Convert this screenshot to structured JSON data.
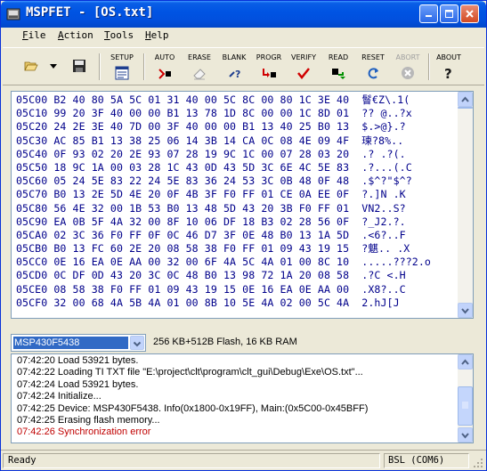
{
  "window": {
    "title": "MSPFET - [OS.txt]"
  },
  "menu": {
    "file": "File",
    "action": "Action",
    "tools": "Tools",
    "help": "Help"
  },
  "toolbar": {
    "setup": "SETUP",
    "auto": "AUTO",
    "erase": "ERASE",
    "blank": "BLANK",
    "program": "PROGR",
    "verify": "VERIFY",
    "read": "READ",
    "reset": "RESET",
    "abort": "ABORT",
    "about": "ABOUT"
  },
  "hex": {
    "rows": [
      "05C00 B2 40 80 5A 5C 01 31 40 00 5C 8C 00 80 1C 3E 40  鬙€Z\\.1(",
      "05C10 99 20 3F 40 00 00 B1 13 78 1D 8C 00 00 1C 8D 01  ?? @..?x",
      "05C20 24 2E 3E 40 7D 00 3F 40 00 00 B1 13 40 25 B0 13  $.>@}.?",
      "05C30 AC 85 B1 13 38 25 06 14 3B 14 CA 0C 08 4E 09 4F  瑓?8%..",
      "05C40 0F 93 02 20 2E 93 07 28 19 9C 1C 00 07 28 03 20  .? .?(.",
      "05C50 18 9C 1A 00 03 28 1C 43 0D 43 5D 3C 6E 4C 5E 83  .?...(.C",
      "05C60 05 24 5E 83 22 24 5E 83 36 24 53 3C 0B 48 0F 48  .$^?\"$^?",
      "05C70 B0 13 2E 5D 4E 20 0F 4B 3F F0 FF 01 CE 0A EE 0F  ?.]N .K",
      "05C80 56 4E 32 00 1B 53 B0 13 48 5D 43 20 3B F0 FF 01  VN2..S?",
      "05C90 EA 0B 5F 4A 32 00 8F 10 06 DF 18 B3 02 28 56 0F  ?_J2.?.",
      "05CA0 02 3C 36 F0 FF 0F 0C 46 D7 3F 0E 48 B0 13 1A 5D  .<6?..F",
      "05CB0 B0 13 FC 60 2E 20 08 58 38 F0 FF 01 09 43 19 15  ?魌.. .X",
      "05CC0 0E 16 EA 0E AA 00 32 00 6F 4A 5C 4A 01 00 8C 10  .....???2.o",
      "05CD0 0C DF 0D 43 20 3C 0C 48 B0 13 98 72 1A 20 08 58  .?C <.H",
      "05CE0 08 58 38 F0 FF 01 09 43 19 15 0E 16 EA 0E AA 00  .X8?..C",
      "05CF0 32 00 68 4A 5B 4A 01 00 8B 10 5E 4A 02 00 5C 4A  2.hJ[J"
    ]
  },
  "device": {
    "selected": "MSP430F5438",
    "info": "256 KB+512B Flash, 16 KB RAM"
  },
  "log": {
    "lines": [
      "07:42:20  Load 53921 bytes.",
      "07:42:22  Loading TI TXT file \"E:\\project\\clt\\program\\clt_gui\\Debug\\Exe\\OS.txt\"...",
      "07:42:24  Load 53921 bytes.",
      "07:42:24  Initialize...",
      "07:42:25  Device: MSP430F5438. Info(0x1800-0x19FF), Main:(0x5C00-0x45BFF)",
      "07:42:25  Erasing flash memory...",
      "07:42:26  Synchronization error"
    ]
  },
  "status": {
    "text": "Ready",
    "port": "BSL (COM6)"
  },
  "colors": {
    "titlebar": "#0054E3",
    "hex_text": "#00008B",
    "error_text": "#C00000",
    "selection": "#316AC5",
    "window_bg": "#ECE9D8"
  }
}
